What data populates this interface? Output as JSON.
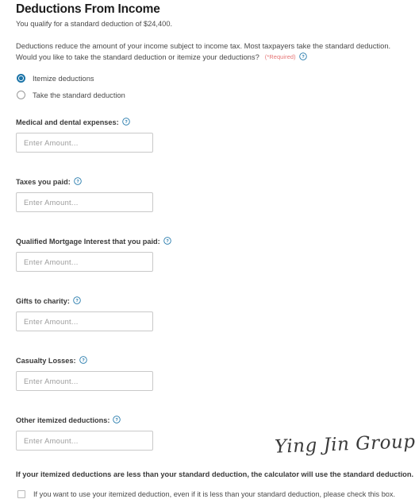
{
  "header": {
    "title": "Deductions From Income",
    "subtitle": "You qualify for a standard deduction of $24,400."
  },
  "intro": {
    "line1": "Deductions reduce the amount of your income subject to income tax. Most taxpayers take the standard deduction.",
    "line2": "Would you like to take the standard deduction or itemize your deductions?",
    "required_tag": "(*Required)",
    "help_icon": "help-circle-icon"
  },
  "radio_group": {
    "options": [
      {
        "label": "Itemize deductions",
        "selected": true
      },
      {
        "label": "Take the standard deduction",
        "selected": false
      }
    ]
  },
  "fields": [
    {
      "label": "Medical and dental expenses:",
      "placeholder": "Enter Amount...",
      "value": "",
      "help_icon": "help-circle-icon"
    },
    {
      "label": "Taxes you paid:",
      "placeholder": "Enter Amount...",
      "value": "",
      "help_icon": "help-circle-icon"
    },
    {
      "label": "Qualified Mortgage Interest that you paid:",
      "placeholder": "Enter Amount...",
      "value": "",
      "help_icon": "help-circle-icon"
    },
    {
      "label": "Gifts to charity:",
      "placeholder": "Enter Amount...",
      "value": "",
      "help_icon": "help-circle-icon"
    },
    {
      "label": "Casualty Losses:",
      "placeholder": "Enter Amount...",
      "value": "",
      "help_icon": "help-circle-icon"
    },
    {
      "label": "Other itemized deductions:",
      "placeholder": "Enter Amount...",
      "value": "",
      "help_icon": "help-circle-icon"
    }
  ],
  "footer": {
    "note": "If your itemized deductions are less than your standard deduction, the calculator will use the standard deduction.",
    "checkbox_label": "If you want to use your itemized deduction, even if it is less than your standard deduction, please check this box.",
    "checkbox_checked": false
  },
  "watermark": {
    "text": "Ying Jin Group"
  },
  "colors": {
    "accent": "#1b74a8",
    "required": "#e57373",
    "text": "#4a4a4a",
    "title": "#1c1c1c",
    "border": "#c9c9c9"
  }
}
